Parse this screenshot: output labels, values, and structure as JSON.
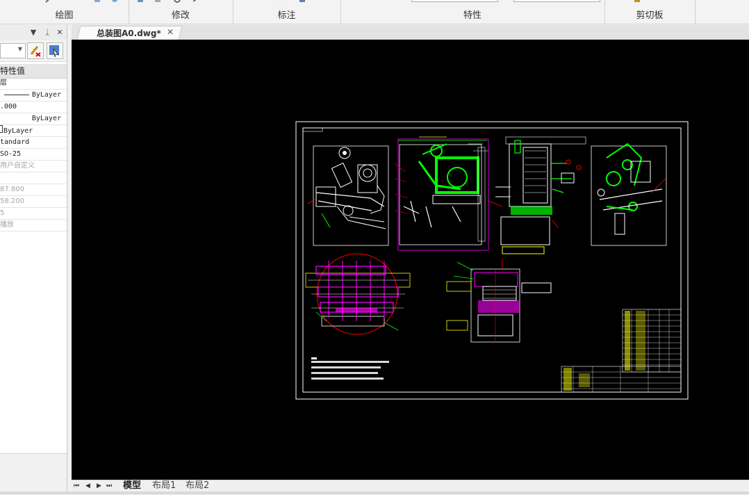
{
  "ribbon": {
    "groups": [
      {
        "label": "绘图"
      },
      {
        "label": "修改"
      },
      {
        "label": "标注"
      },
      {
        "label": "特性"
      },
      {
        "label": "剪切板"
      }
    ]
  },
  "panel": {
    "header_icons": [
      "dropdown-icon",
      "pin-icon",
      "close-icon"
    ],
    "column_header": "特性值",
    "rows": [
      {
        "text": "层",
        "style": "normal"
      },
      {
        "text": "ByLayer",
        "style": "line"
      },
      {
        "text": ".000",
        "style": "normal"
      },
      {
        "text": "ByLayer",
        "style": "right"
      },
      {
        "text": "ByLayer",
        "style": "normal"
      },
      {
        "text": "tandard",
        "style": "normal"
      },
      {
        "text": "SO-25",
        "style": "normal"
      },
      {
        "text": "用户自定义",
        "style": "gray"
      },
      {
        "text": "",
        "style": "gray"
      },
      {
        "text": "87.800",
        "style": "gray"
      },
      {
        "text": "58.200",
        "style": "gray"
      },
      {
        "text": "5",
        "style": "gray"
      },
      {
        "text": "播放",
        "style": "gray"
      }
    ]
  },
  "document": {
    "tab_title": "总装图A0.dwg*",
    "close": "✕"
  },
  "layout_tabs": [
    {
      "label": "模型",
      "active": true
    },
    {
      "label": "布局1",
      "active": false
    },
    {
      "label": "布局2",
      "active": false
    }
  ],
  "nav_buttons": [
    "⏮",
    "◀",
    "▶",
    "⏭"
  ],
  "colors": {
    "canvas": "#000000",
    "cad_white": "#ffffff",
    "cad_green": "#00ff00",
    "cad_magenta": "#ff00ff",
    "cad_red": "#ff0000",
    "cad_yellow": "#ffff00"
  }
}
